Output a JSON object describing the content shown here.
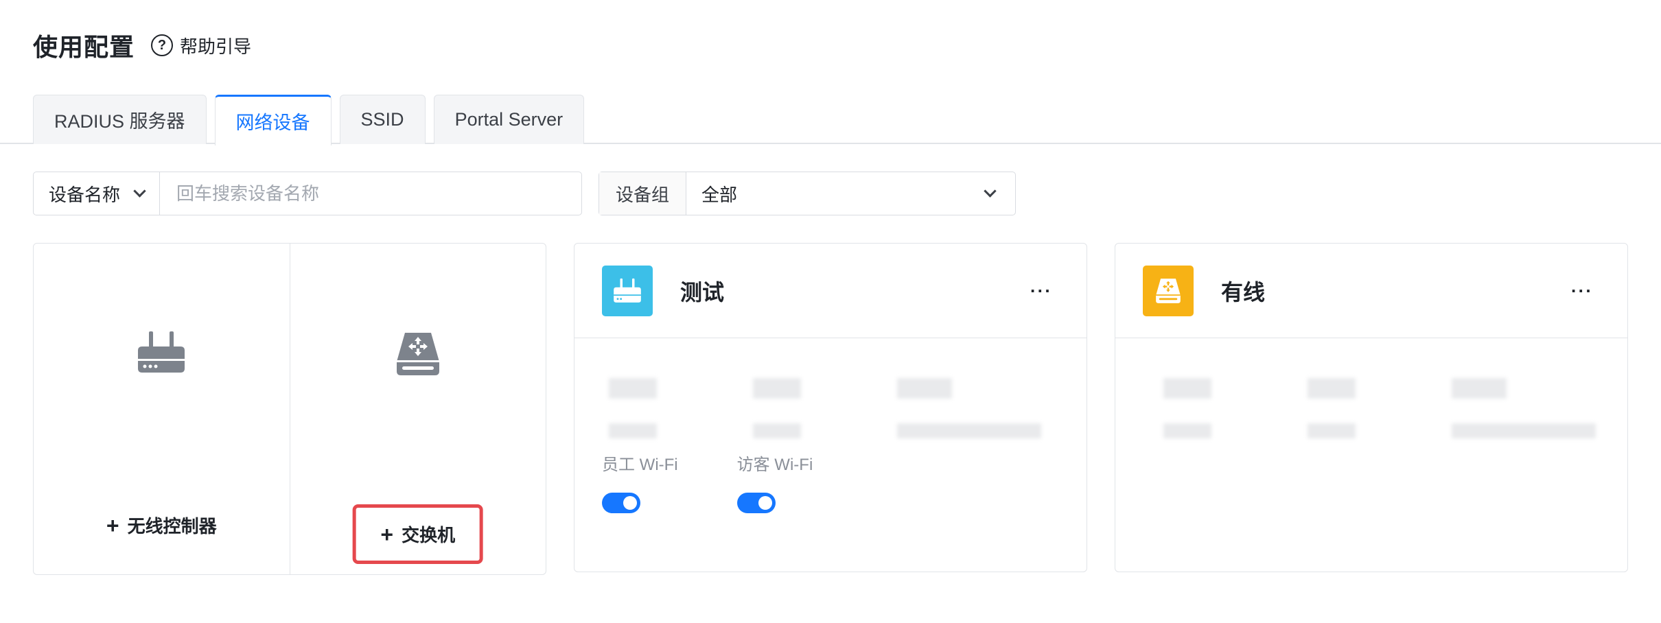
{
  "header": {
    "title": "使用配置",
    "help_icon_glyph": "?",
    "help_label": "帮助引导"
  },
  "tabs": [
    {
      "label": "RADIUS 服务器",
      "active": false
    },
    {
      "label": "网络设备",
      "active": true
    },
    {
      "label": "SSID",
      "active": false
    },
    {
      "label": "Portal Server",
      "active": false
    }
  ],
  "filters": {
    "field_select": "设备名称",
    "search_placeholder": "回车搜索设备名称",
    "group_label": "设备组",
    "group_value": "全部"
  },
  "add_card": {
    "wireless_label": "无线控制器",
    "switch_label": "交换机",
    "plus": "+",
    "wireless_icon": "router-icon",
    "switch_icon": "switch-icon"
  },
  "devices": [
    {
      "name": "测试",
      "icon": "router-icon",
      "badge_color": "#3cbfe8",
      "more": "···",
      "wifi": [
        {
          "label": "员工 Wi-Fi",
          "enabled": true
        },
        {
          "label": "访客 Wi-Fi",
          "enabled": true
        }
      ]
    },
    {
      "name": "有线",
      "icon": "switch-icon",
      "badge_color": "#f7b215",
      "more": "···"
    }
  ],
  "colors": {
    "accent": "#1677ff",
    "highlight": "#e5484d",
    "icon_gray": "#7d838c"
  }
}
